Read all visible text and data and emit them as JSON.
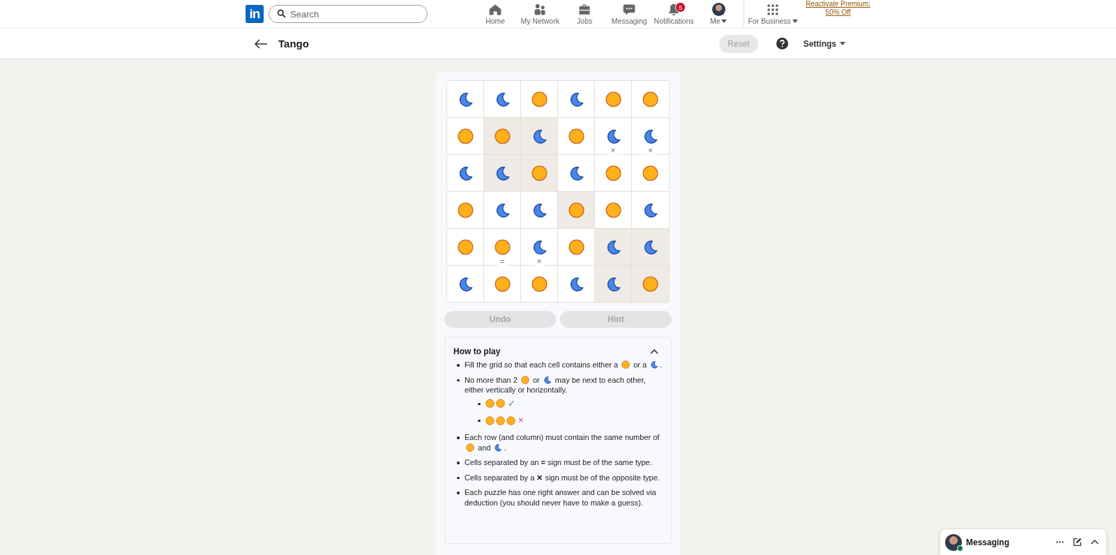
{
  "nav": {
    "logo": "in",
    "search": {
      "placeholder": "Search"
    },
    "items": [
      {
        "kind": "home",
        "label": "Home"
      },
      {
        "kind": "network",
        "label": "My Network"
      },
      {
        "kind": "jobs",
        "label": "Jobs"
      },
      {
        "kind": "messaging",
        "label": "Messaging"
      },
      {
        "kind": "notifications",
        "label": "Notifications",
        "badge": "5"
      },
      {
        "kind": "me",
        "label": "Me"
      },
      {
        "kind": "business",
        "label": "For Business"
      }
    ],
    "premium": {
      "line1": "Reactivate Premium:",
      "line2": "50% Off"
    }
  },
  "header": {
    "title": "Tango",
    "reset": {
      "label": "Reset",
      "disabled": true
    },
    "settings": "Settings"
  },
  "grid": [
    [
      {
        "kind": "moon",
        "locked": false
      },
      {
        "kind": "moon",
        "locked": false
      },
      {
        "kind": "sun",
        "locked": false
      },
      {
        "kind": "moon",
        "locked": false
      },
      {
        "kind": "sun",
        "locked": false
      },
      {
        "kind": "sun",
        "locked": false
      }
    ],
    [
      {
        "kind": "sun",
        "locked": false
      },
      {
        "kind": "sun",
        "locked": true
      },
      {
        "kind": "moon",
        "locked": true
      },
      {
        "kind": "sun",
        "locked": false
      },
      {
        "kind": "moon",
        "locked": false,
        "below_sign": "×"
      },
      {
        "kind": "moon",
        "locked": false,
        "below_sign": "×"
      }
    ],
    [
      {
        "kind": "moon",
        "locked": false
      },
      {
        "kind": "moon",
        "locked": true
      },
      {
        "kind": "sun",
        "locked": true
      },
      {
        "kind": "moon",
        "locked": false
      },
      {
        "kind": "sun",
        "locked": false
      },
      {
        "kind": "sun",
        "locked": false
      }
    ],
    [
      {
        "kind": "sun",
        "locked": false
      },
      {
        "kind": "moon",
        "locked": false
      },
      {
        "kind": "moon",
        "locked": false
      },
      {
        "kind": "sun",
        "locked": true
      },
      {
        "kind": "sun",
        "locked": false
      },
      {
        "kind": "moon",
        "locked": false
      }
    ],
    [
      {
        "kind": "sun",
        "locked": false
      },
      {
        "kind": "sun",
        "locked": false,
        "below_sign": "="
      },
      {
        "kind": "moon",
        "locked": false,
        "below_sign": "×"
      },
      {
        "kind": "sun",
        "locked": false
      },
      {
        "kind": "moon",
        "locked": true
      },
      {
        "kind": "moon",
        "locked": true
      }
    ],
    [
      {
        "kind": "moon",
        "locked": false
      },
      {
        "kind": "sun",
        "locked": false
      },
      {
        "kind": "sun",
        "locked": false
      },
      {
        "kind": "moon",
        "locked": false
      },
      {
        "kind": "moon",
        "locked": true
      },
      {
        "kind": "sun",
        "locked": true
      }
    ]
  ],
  "actions": [
    {
      "label": "Undo",
      "disabled": true
    },
    {
      "label": "Hint",
      "disabled": true
    }
  ],
  "how_to_play": {
    "title": "How to play",
    "expanded": true,
    "rules": [
      {
        "parts": [
          {
            "kind": "text",
            "text": "Fill the grid so that each cell contains either a"
          },
          {
            "kind": "sun"
          },
          {
            "kind": "text",
            "text": "or a"
          },
          {
            "kind": "moon"
          },
          {
            "kind": "text",
            "text": "."
          }
        ]
      },
      {
        "parts": [
          {
            "kind": "text",
            "text": "No more than 2"
          },
          {
            "kind": "sun"
          },
          {
            "kind": "text",
            "text": "or"
          },
          {
            "kind": "moon"
          },
          {
            "kind": "text",
            "text": "may be next to each other, either vertically or horizontally."
          }
        ],
        "examples": [
          {
            "icons": [
              {
                "kind": "sun"
              },
              {
                "kind": "sun"
              }
            ],
            "mark": "✓",
            "valid": true
          },
          {
            "icons": [
              {
                "kind": "sun"
              },
              {
                "kind": "sun"
              },
              {
                "kind": "sun"
              }
            ],
            "mark": "×",
            "valid": false
          }
        ]
      },
      {
        "parts": [
          {
            "kind": "text",
            "text": "Each row (and column) must contain the same number of"
          },
          {
            "kind": "sun"
          },
          {
            "kind": "text",
            "text": "and"
          },
          {
            "kind": "moon"
          },
          {
            "kind": "text",
            "text": "."
          }
        ]
      },
      {
        "parts": [
          {
            "kind": "text",
            "text": "Cells separated by an **=** sign must be of the same type."
          }
        ]
      },
      {
        "parts": [
          {
            "kind": "text",
            "text": "Cells separated by a **✕** sign must be of the opposite type."
          }
        ]
      },
      {
        "parts": [
          {
            "kind": "text",
            "text": "Each puzzle has one right answer and can be solved via deduction (you should never have to make a guess)."
          }
        ]
      }
    ]
  },
  "messaging": {
    "title": "Messaging",
    "online": true
  }
}
